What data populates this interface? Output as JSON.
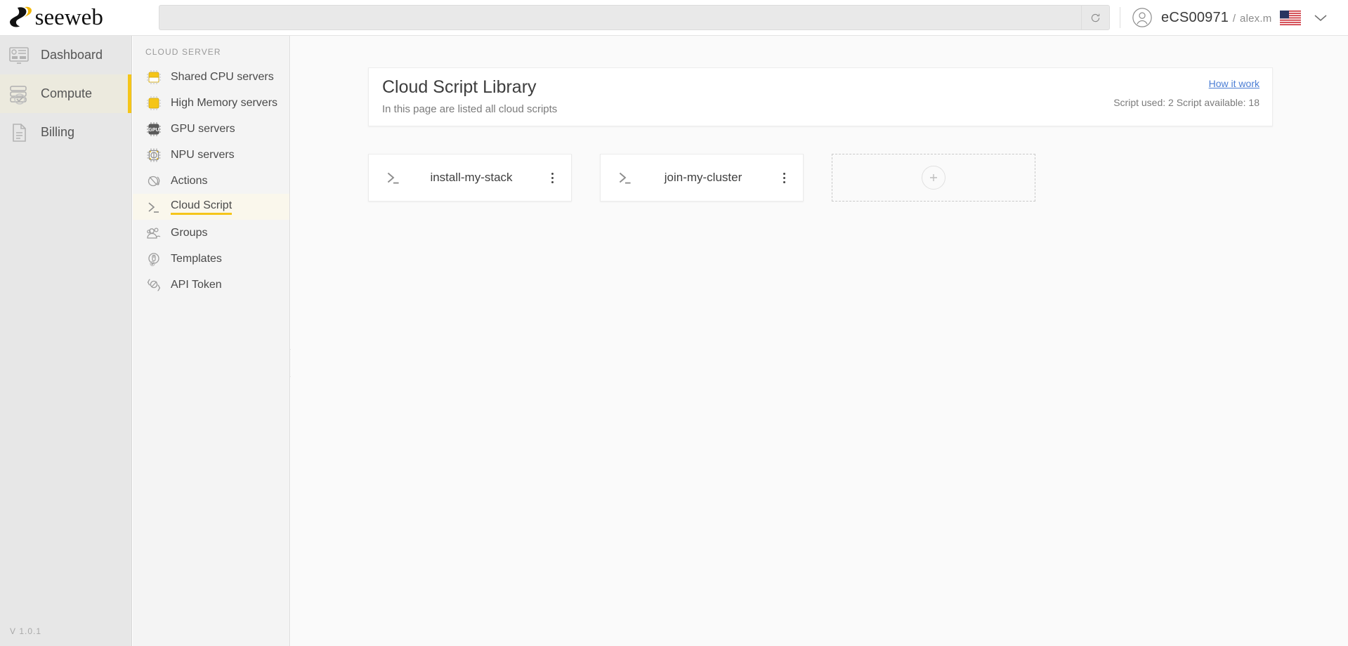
{
  "brand": {
    "name": "seeweb",
    "accent_color": "#f5c518"
  },
  "topbar": {
    "search": {
      "value": "",
      "placeholder": ""
    },
    "refresh_label": "refresh-icon",
    "user": {
      "account": "eCS00971",
      "separator": "/",
      "username": "alex.m"
    },
    "locale": {
      "flag": "us-flag",
      "caret": "chevron-down-icon"
    }
  },
  "sidebar": {
    "items": [
      {
        "label": "Dashboard",
        "icon": "dashboard-icon",
        "active": false
      },
      {
        "label": "Compute",
        "icon": "server-stack-icon",
        "active": true
      },
      {
        "label": "Billing",
        "icon": "document-icon",
        "active": false
      }
    ],
    "version": "V 1.0.1"
  },
  "subnav": {
    "title": "CLOUD SERVER",
    "items": [
      {
        "label": "Shared CPU servers",
        "icon": "cpu-chip-icon",
        "active": false
      },
      {
        "label": "High Memory servers",
        "icon": "memory-chip-icon",
        "active": false
      },
      {
        "label": "GPU servers",
        "icon": "gpu-chip-icon",
        "active": false
      },
      {
        "label": "NPU servers",
        "icon": "npu-chip-icon",
        "active": false
      },
      {
        "label": "Actions",
        "icon": "actions-icon",
        "active": false
      },
      {
        "label": "Cloud Script",
        "icon": "terminal-icon",
        "active": true
      },
      {
        "label": "Groups",
        "icon": "groups-icon",
        "active": false
      },
      {
        "label": "Templates",
        "icon": "templates-icon",
        "active": false
      },
      {
        "label": "API Token",
        "icon": "api-token-icon",
        "active": false
      }
    ],
    "collapse_icon": "double-chevron-left-icon"
  },
  "page": {
    "title": "Cloud Script Library",
    "subtitle": "In this page are listed all cloud scripts",
    "how_it_work_link": "How it work",
    "quota": "Script used: 2 Script available: 18",
    "scripts": [
      {
        "name": "install-my-stack",
        "icon": "terminal-icon",
        "menu": "kebab-menu-icon"
      },
      {
        "name": "join-my-cluster",
        "icon": "terminal-icon",
        "menu": "kebab-menu-icon"
      }
    ],
    "add_tile": {
      "icon": "plus-icon"
    }
  }
}
